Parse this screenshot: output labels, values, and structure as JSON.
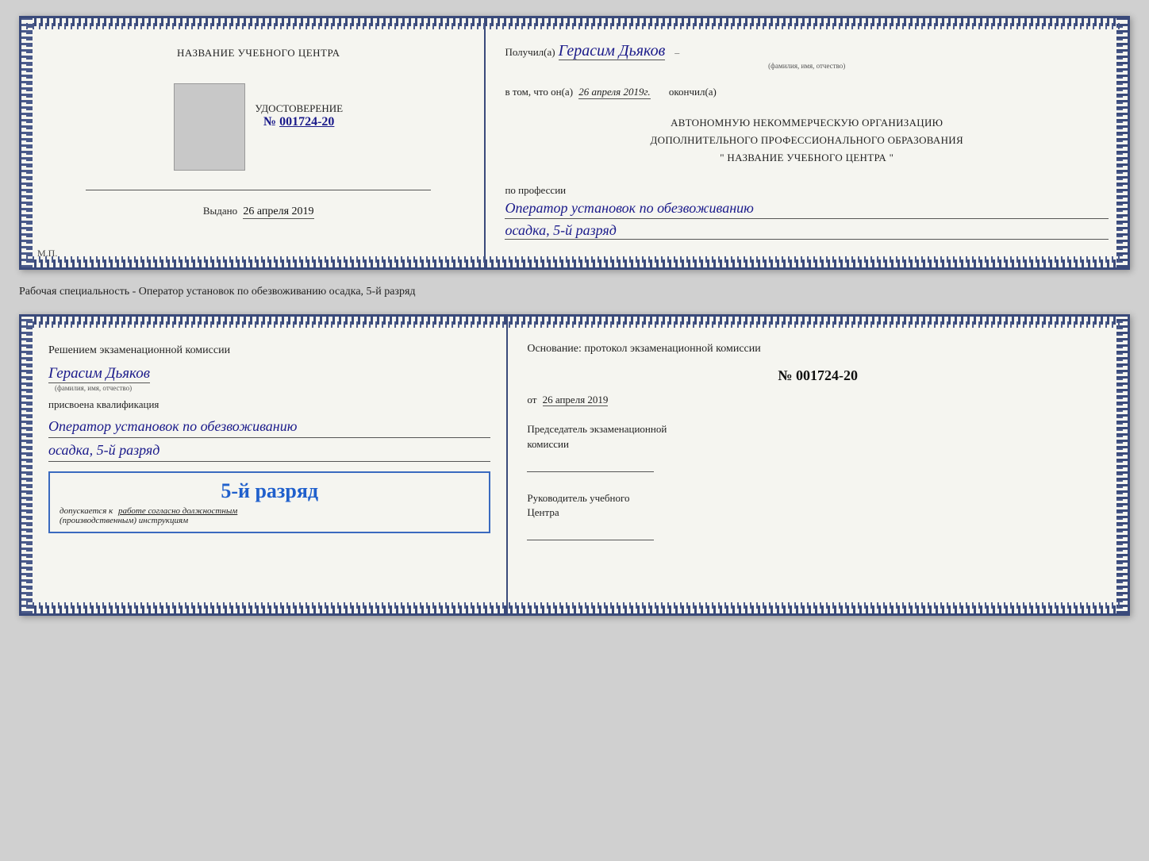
{
  "top_cert": {
    "left": {
      "title": "НАЗВАНИЕ УЧЕБНОГО ЦЕНТРА",
      "document_type": "УДОСТОВЕРЕНИЕ",
      "number_prefix": "№",
      "number": "001724-20",
      "issued_label": "Выдано",
      "issued_date": "26 апреля 2019",
      "mp_label": "М.П."
    },
    "right": {
      "received_prefix": "Получил(а)",
      "recipient_name": "Герасим Дьяков",
      "name_subtext": "(фамилия, имя, отчество)",
      "date_label": "в том, что он(а)",
      "date_value": "26 апреля 2019г.",
      "finished_label": "окончил(а)",
      "org_line1": "АВТОНОМНУЮ НЕКОММЕРЧЕСКУЮ ОРГАНИЗАЦИЮ",
      "org_line2": "ДОПОЛНИТЕЛЬНОГО ПРОФЕССИОНАЛЬНОГО ОБРАЗОВАНИЯ",
      "org_line3": "\" НАЗВАНИЕ УЧЕБНОГО ЦЕНТРА \"",
      "profession_label": "по профессии",
      "profession_value": "Оператор установок по обезвоживанию",
      "specialty_value": "осадка, 5-й разряд"
    }
  },
  "middle_text": "Рабочая специальность - Оператор установок по обезвоживанию осадка, 5-й разряд",
  "bottom_cert": {
    "left": {
      "commission_title": "Решением экзаменационной комиссии",
      "person_name": "Герасим Дьяков",
      "name_subtext": "(фамилия, имя, отчество)",
      "qualification_label": "присвоена квалификация",
      "qualification_line1": "Оператор установок по обезвоживанию",
      "qualification_line2": "осадка, 5-й разряд",
      "rank_text": "5-й разряд",
      "допуск_prefix": "допускается к",
      "допуск_underline": "работе согласно должностным",
      "допуск_suffix": "(производственным) инструкциям"
    },
    "right": {
      "basis_label": "Основание: протокол экзаменационной комиссии",
      "protocol_number": "№ 001724-20",
      "date_prefix": "от",
      "date_value": "26 апреля 2019",
      "chairman_label": "Председатель экзаменационной",
      "chairman_label2": "комиссии",
      "head_label": "Руководитель учебного",
      "head_label2": "Центра"
    }
  }
}
